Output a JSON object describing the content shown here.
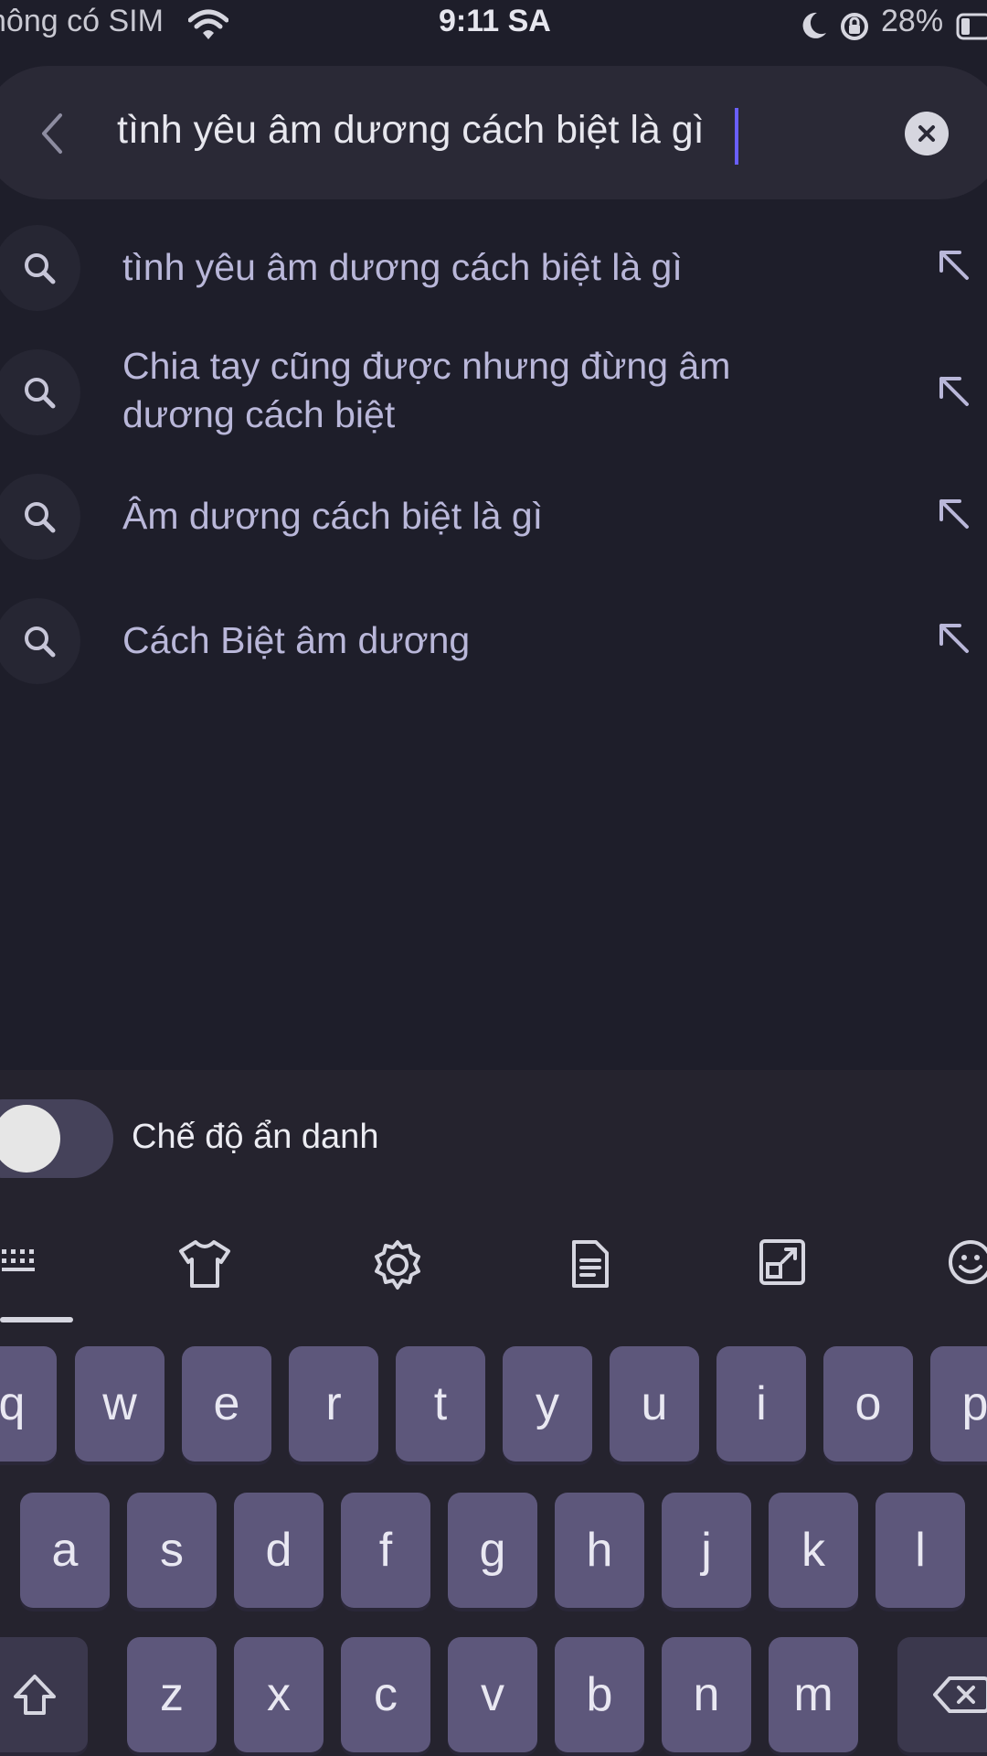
{
  "status_bar": {
    "carrier": "hông có SIM",
    "time": "9:11 SA",
    "battery": "28%"
  },
  "search": {
    "query": "tình yêu âm dương cách biệt là gì"
  },
  "suggestions": [
    {
      "text": "tình yêu âm dương cách biệt là gì"
    },
    {
      "text": "Chia tay cũng được nhưng đừng âm dương cách biệt"
    },
    {
      "text": "Âm dương cách biệt là gì"
    },
    {
      "text": "Cách Biệt âm dương"
    }
  ],
  "keyboard": {
    "incognito_label": "Chế độ ẩn danh",
    "incognito_on": false,
    "toolbar_icons": [
      "keyboard-icon",
      "tshirt-icon",
      "gear-icon",
      "document-icon",
      "resize-icon",
      "emoji-icon"
    ],
    "row1": [
      "q",
      "w",
      "e",
      "r",
      "t",
      "y",
      "u",
      "i",
      "o",
      "p"
    ],
    "row2": [
      "a",
      "s",
      "d",
      "f",
      "g",
      "h",
      "j",
      "k",
      "l"
    ],
    "row3": [
      "z",
      "x",
      "c",
      "v",
      "b",
      "n",
      "m"
    ]
  },
  "colors": {
    "background": "#1e1e2a",
    "suggestion_text": "#b9b7d9",
    "key": "#5d577b",
    "caret": "#6a5fff"
  }
}
